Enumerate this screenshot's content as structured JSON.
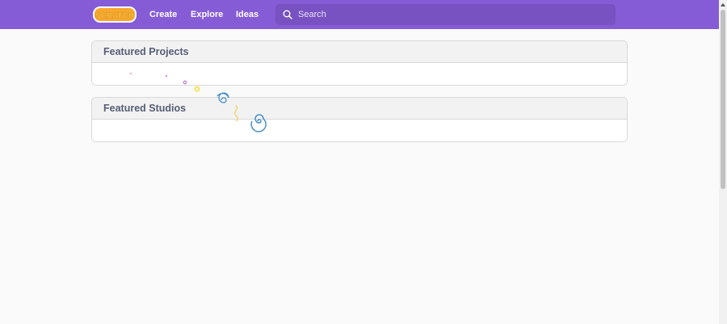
{
  "navbar": {
    "logo_text": "SCRATCH",
    "links": [
      "Create",
      "Explore",
      "Ideas"
    ],
    "search_placeholder": "Search",
    "color": "#855cd6"
  },
  "panels": [
    {
      "title": "Featured Projects"
    },
    {
      "title": "Featured Studios"
    }
  ]
}
